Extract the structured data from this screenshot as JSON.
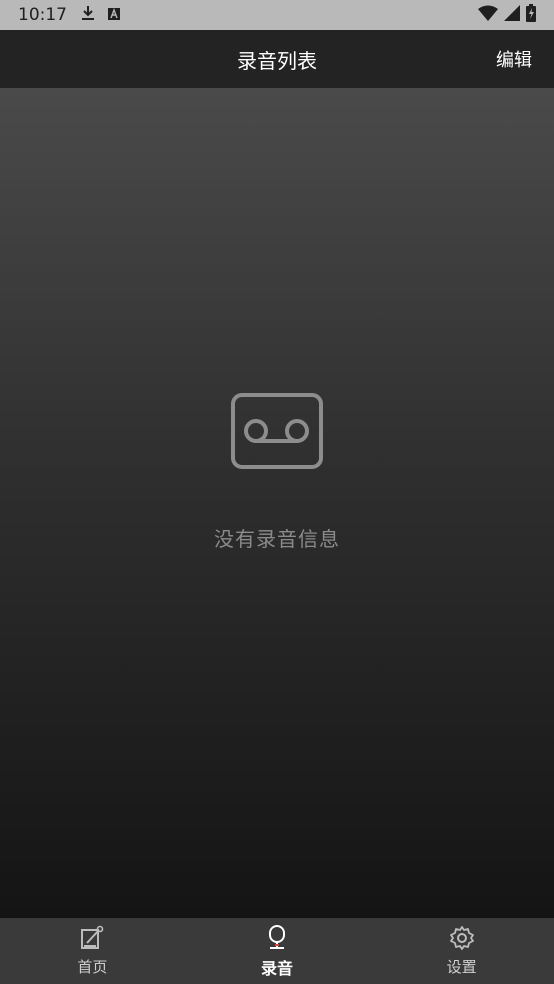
{
  "status_bar": {
    "time": "10:17",
    "icons": [
      "download-icon",
      "keyboard-a-icon",
      "wifi-icon",
      "signal-icon",
      "battery-charging-icon"
    ]
  },
  "app_bar": {
    "title": "录音列表",
    "edit_label": "编辑"
  },
  "empty_state": {
    "icon": "cassette-icon",
    "message": "没有录音信息"
  },
  "bottom_nav": {
    "items": [
      {
        "label": "首页",
        "icon": "edit-note-icon",
        "active": false
      },
      {
        "label": "录音",
        "icon": "microphone-icon",
        "active": true
      },
      {
        "label": "设置",
        "icon": "gear-icon",
        "active": false
      }
    ]
  },
  "colors": {
    "status_bar_bg": "#b9b9b9",
    "app_bar_bg": "#232323",
    "nav_bg": "#3a3a3a",
    "empty_text": "#8b8b8b"
  }
}
